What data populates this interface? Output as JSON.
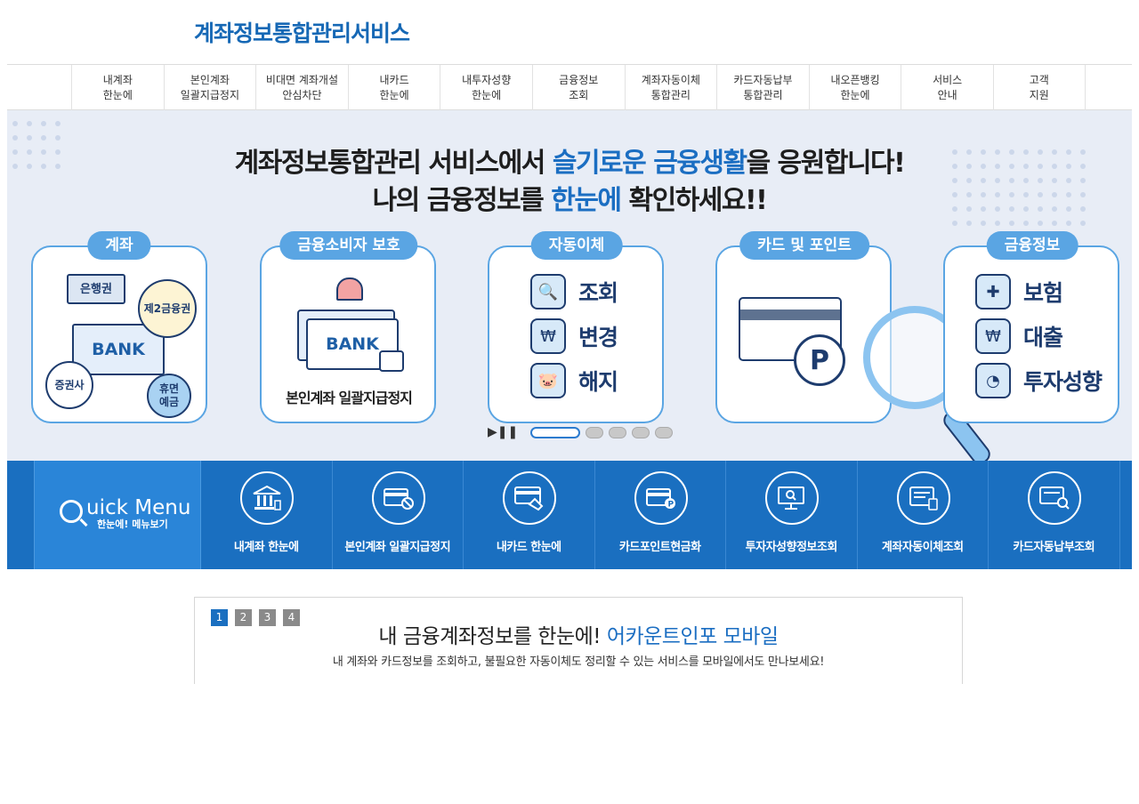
{
  "header": {
    "logo_text": "계좌정보통합관리서비스"
  },
  "nav": {
    "items": [
      {
        "label": "내계좌\n한눈에"
      },
      {
        "label": "본인계좌\n일괄지급정지"
      },
      {
        "label": "비대면 계좌개설\n안심차단"
      },
      {
        "label": "내카드\n한눈에"
      },
      {
        "label": "내투자성향\n한눈에"
      },
      {
        "label": "금융정보\n조회"
      },
      {
        "label": "계좌자동이체\n통합관리"
      },
      {
        "label": "카드자동납부\n통합관리"
      },
      {
        "label": "내오픈뱅킹\n한눈에"
      },
      {
        "label": "서비스\n안내"
      },
      {
        "label": "고객\n지원"
      }
    ]
  },
  "banner": {
    "line1_pre": "계좌정보통합관리 서비스에서 ",
    "line1_hl": "슬기로운 금융생활",
    "line1_post": "을 응원합니다!",
    "line2_pre": "나의 금융정보를 ",
    "line2_hl": "한눈에",
    "line2_post": " 확인하세요!!",
    "cards": {
      "account": {
        "tag": "계좌",
        "bubble1": "은행권",
        "bubble2": "제2금융권",
        "bank": "BANK",
        "bubble3": "증권사",
        "bubble4": "휴면\n예금"
      },
      "protect": {
        "tag": "금융소비자 보호",
        "bank": "BANK",
        "caption": "본인계좌 일괄지급정지"
      },
      "autopay": {
        "tag": "자동이체",
        "rows": [
          "조회",
          "변경",
          "해지"
        ]
      },
      "card": {
        "tag": "카드 및 포인트",
        "point": "P"
      },
      "info": {
        "tag": "금융정보",
        "rows": [
          "보험",
          "대출",
          "투자성향"
        ]
      }
    },
    "slider": {
      "total": 5,
      "active": 0
    }
  },
  "quick_menu": {
    "title": "uick Menu",
    "title_q": "Q",
    "subtitle": "한눈에! 메뉴보기",
    "items": [
      {
        "label": "내계좌 한눈에",
        "icon": "bank-icon"
      },
      {
        "label": "본인계좌 일괄지급정지",
        "icon": "card-block-icon"
      },
      {
        "label": "내카드 한눈에",
        "icon": "card-hand-icon"
      },
      {
        "label": "카드포인트현금화",
        "icon": "card-point-icon"
      },
      {
        "label": "투자자성향정보조회",
        "icon": "monitor-search-icon"
      },
      {
        "label": "계좌자동이체조회",
        "icon": "auto-transfer-icon"
      },
      {
        "label": "카드자동납부조회",
        "icon": "card-autopay-icon"
      }
    ]
  },
  "mobile": {
    "pages": [
      "1",
      "2",
      "3",
      "4"
    ],
    "active_page": 0,
    "title_pre": "내 금융계좌정보를 한눈에! ",
    "title_hl": "어카운트인포 모바일",
    "desc": "내 계좌와 카드정보를 조회하고, 불필요한 자동이체도 정리할 수 있는 서비스를 모바일에서도 만나보세요!"
  }
}
